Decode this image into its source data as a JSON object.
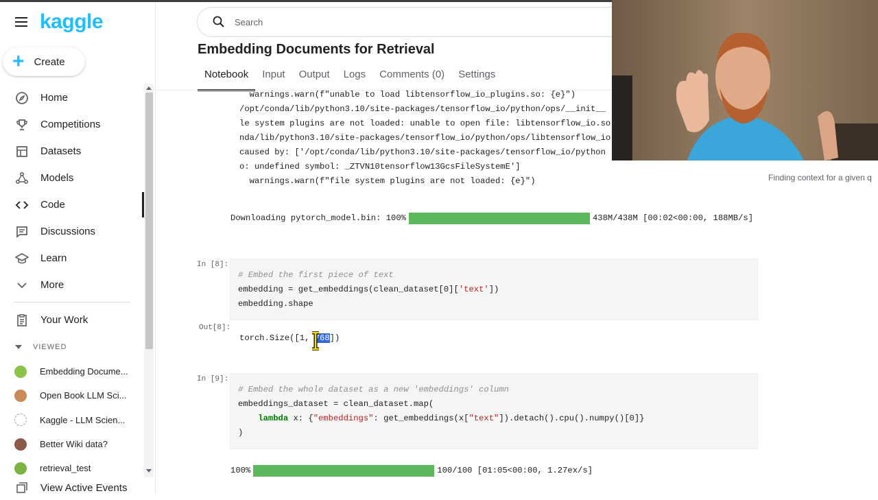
{
  "brand": {
    "logo": "kaggle",
    "accent": "#20beff"
  },
  "sidebar": {
    "create_label": "Create",
    "nav": [
      {
        "label": "Home",
        "icon": "compass-icon"
      },
      {
        "label": "Competitions",
        "icon": "trophy-icon"
      },
      {
        "label": "Datasets",
        "icon": "table-icon"
      },
      {
        "label": "Models",
        "icon": "models-icon"
      },
      {
        "label": "Code",
        "icon": "code-icon",
        "active": true
      },
      {
        "label": "Discussions",
        "icon": "discussions-icon"
      },
      {
        "label": "Learn",
        "icon": "graduation-cap-icon"
      },
      {
        "label": "More",
        "icon": "chevron-down-icon"
      }
    ],
    "your_work": "Your Work",
    "viewed_heading": "VIEWED",
    "recent": [
      {
        "label": "Embedding Docume...",
        "color": "#8bc34a"
      },
      {
        "label": "Open Book LLM Sci...",
        "color": "#c98a5a"
      },
      {
        "label": "Kaggle - LLM Scien...",
        "color": "#9e9e9e"
      },
      {
        "label": "Better Wiki data?",
        "color": "#8d5a4a"
      },
      {
        "label": "retrieval_test",
        "color": "#7cb342"
      }
    ],
    "view_active_events": "View Active Events"
  },
  "search": {
    "placeholder": "Search"
  },
  "notebook": {
    "title": "Embedding Documents for Retrieval",
    "tabs": [
      "Notebook",
      "Input",
      "Output",
      "Logs",
      "Comments (0)",
      "Settings"
    ],
    "active_tab": "Notebook"
  },
  "stderr_lines": [
    "  warnings.warn(f\"unable to load libtensorflow_io_plugins.so: {e}\")",
    "/opt/conda/lib/python3.10/site-packages/tensorflow_io/python/ops/__init__",
    "le system plugins are not loaded: unable to open file: libtensorflow_io.so",
    "nda/lib/python3.10/site-packages/tensorflow_io/python/ops/libtensorflow_io",
    "caused by: ['/opt/conda/lib/python3.10/site-packages/tensorflow_io/python",
    "o: undefined symbol: _ZTVN10tensorflow13GcsFileSystemE']",
    "  warnings.warn(f\"file system plugins are not loaded: {e}\")"
  ],
  "download_progress": {
    "label": "Downloading pytorch_model.bin: 100%",
    "fraction": 1.0,
    "stats": "438M/438M [00:02<00:00, 188MB/s]"
  },
  "cell8": {
    "in_prompt": "In [8]:",
    "out_prompt": "Out[8]:",
    "comment": "# Embed the first piece of text",
    "line2_a": "embedding = get_embeddings(clean_dataset[0][",
    "line2_str": "'text'",
    "line2_b": "])",
    "line3": "embedding.shape",
    "output_prefix": "torch.Size([1, ",
    "output_selected": "768",
    "output_suffix": "])"
  },
  "cell9": {
    "in_prompt": "In [9]:",
    "comment": "# Embed the whole dataset as a new 'embeddings' column",
    "line2": "embeddings_dataset = clean_dataset.map(",
    "line3_kw": "lambda",
    "line3_a": " x: {",
    "line3_str1": "\"embeddings\"",
    "line3_b": ": get_embeddings(x[",
    "line3_str2": "\"text\"",
    "line3_c": "]).detach().cpu().numpy()[0]}",
    "line4": ")"
  },
  "map_progress": {
    "label": "100%",
    "fraction": 1.0,
    "stats": "100/100 [01:05<00:00, 1.27ex/s]"
  },
  "side_caption": "Finding context for a given q"
}
